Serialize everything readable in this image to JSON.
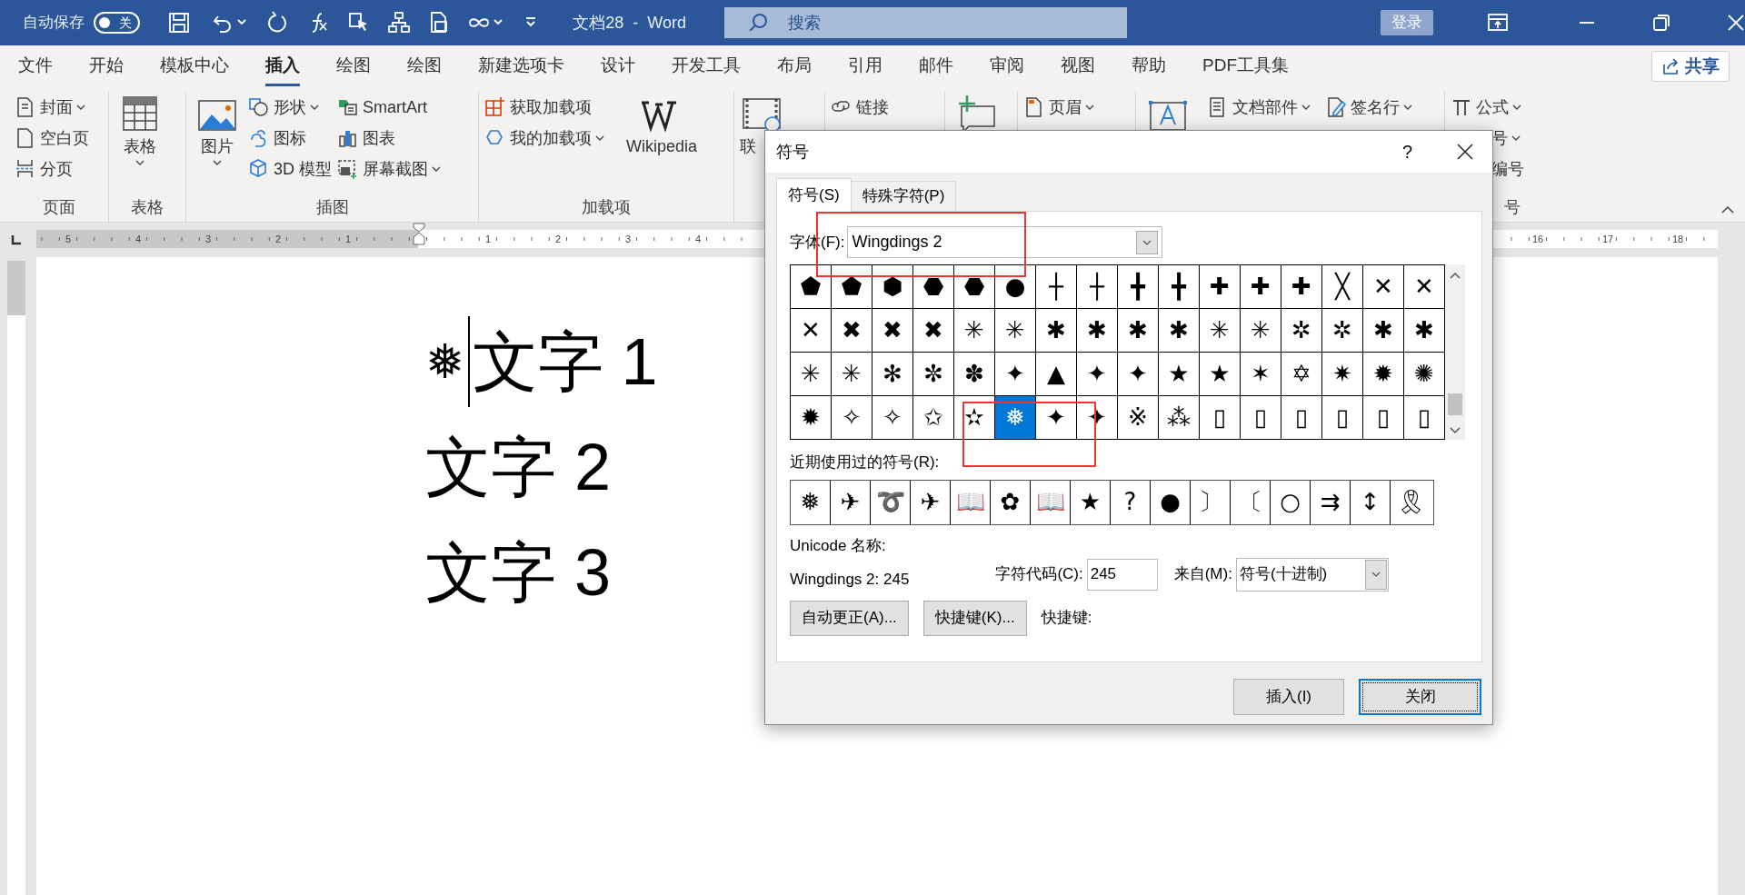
{
  "title_bar": {
    "autosave_label": "自动保存",
    "autosave": {
      "on": false,
      "label": "关"
    },
    "document_title": "文档28  -  Word",
    "search_placeholder": "搜索",
    "login": "登录"
  },
  "ribbon_tabs": [
    {
      "label": "文件",
      "selected": false
    },
    {
      "label": "开始",
      "selected": false
    },
    {
      "label": "模板中心",
      "selected": false
    },
    {
      "label": "插入",
      "selected": true
    },
    {
      "label": "绘图",
      "selected": false
    },
    {
      "label": "绘图",
      "selected": false
    },
    {
      "label": "新建选项卡",
      "selected": false
    },
    {
      "label": "设计",
      "selected": false
    },
    {
      "label": "开发工具",
      "selected": false
    },
    {
      "label": "布局",
      "selected": false
    },
    {
      "label": "引用",
      "selected": false
    },
    {
      "label": "邮件",
      "selected": false
    },
    {
      "label": "审阅",
      "selected": false
    },
    {
      "label": "视图",
      "selected": false
    },
    {
      "label": "帮助",
      "selected": false
    },
    {
      "label": "PDF工具集",
      "selected": false
    }
  ],
  "share": "共享",
  "ribbon_groups": [
    {
      "label": "页面",
      "columns": [
        [
          {
            "kind": "small",
            "label": "封面",
            "dropdown": true
          },
          {
            "kind": "small",
            "label": "空白页",
            "dropdown": false
          },
          {
            "kind": "small",
            "label": "分页",
            "dropdown": false
          }
        ]
      ]
    },
    {
      "label": "表格",
      "columns": [
        [
          {
            "kind": "large",
            "label": "表格",
            "dropdown": true
          }
        ]
      ]
    },
    {
      "label": "插图",
      "columns": [
        [
          {
            "kind": "large",
            "label": "图片",
            "dropdown": true
          }
        ],
        [
          {
            "kind": "small",
            "label": "形状",
            "dropdown": true
          },
          {
            "kind": "small",
            "label": "图标",
            "dropdown": false
          },
          {
            "kind": "small",
            "label": "3D 模型",
            "dropdown": false
          }
        ],
        [
          {
            "kind": "small",
            "label": "SmartArt",
            "dropdown": false
          },
          {
            "kind": "small",
            "label": "图表",
            "dropdown": false
          },
          {
            "kind": "small",
            "label": "屏幕截图",
            "dropdown": true
          }
        ]
      ]
    },
    {
      "label": "加载项",
      "columns": [
        [
          {
            "kind": "small",
            "label": "获取加载项",
            "dropdown": false
          },
          {
            "kind": "small",
            "label": "我的加载项",
            "dropdown": true
          }
        ],
        [
          {
            "kind": "large",
            "label": "Wikipedia",
            "dropdown": false
          }
        ]
      ]
    },
    {
      "columns": [
        [
          {
            "kind": "large",
            "label": "联",
            "dropdown": false
          }
        ]
      ]
    },
    {
      "columns": [
        [
          {
            "kind": "small",
            "label": "链接",
            "dropdown": false
          }
        ]
      ]
    },
    {
      "columns": [
        [
          {
            "kind": "large",
            "dropdown": false
          }
        ]
      ]
    },
    {
      "columns": [
        [
          {
            "kind": "small",
            "label": "页眉",
            "dropdown": true
          }
        ]
      ]
    },
    {
      "columns": [
        [
          {
            "kind": "large",
            "dropdown": false
          }
        ],
        [
          {
            "kind": "small",
            "label": "文档部件",
            "dropdown": true
          }
        ],
        [
          {
            "kind": "small",
            "label": "签名行",
            "dropdown": true
          }
        ]
      ]
    },
    {
      "label": "号",
      "columns": [
        [
          {
            "kind": "small",
            "label": "公式",
            "dropdown": true
          },
          {
            "kind": "small",
            "label": "号",
            "dropdown": true
          },
          {
            "kind": "small",
            "label": "编号",
            "dropdown": false
          }
        ]
      ]
    }
  ],
  "ruler": {
    "left_numbers": [
      "5",
      "4",
      "3",
      "2",
      "1"
    ],
    "right_numbers": [
      "1",
      "2",
      "3",
      "4"
    ],
    "far_numbers": [
      "16",
      "17",
      "18"
    ]
  },
  "document": {
    "lines": [
      {
        "symbol": "❅",
        "text": "文字 1",
        "cursor": true
      },
      {
        "text": "文字 2",
        "cursor": false
      },
      {
        "text": "文字 3",
        "cursor": false
      }
    ]
  },
  "dialog": {
    "title": "符号",
    "help": "?",
    "tabs": [
      {
        "label": "符号(S)",
        "selected": true
      },
      {
        "label": "特殊字符(P)",
        "selected": false
      }
    ],
    "font_label": "字体(F):",
    "font_value": "Wingdings 2",
    "symbols": [
      {
        "char": "⬟",
        "selected": false
      },
      {
        "char": "⬟",
        "selected": false
      },
      {
        "char": "⬢",
        "selected": false
      },
      {
        "char": "⬣",
        "selected": false
      },
      {
        "char": "⬣",
        "selected": false
      },
      {
        "char": "●",
        "selected": false
      },
      {
        "char": "┼",
        "selected": false
      },
      {
        "char": "┼",
        "selected": false
      },
      {
        "char": "╋",
        "selected": false
      },
      {
        "char": "╋",
        "selected": false
      },
      {
        "char": "✚",
        "selected": false
      },
      {
        "char": "✚",
        "selected": false
      },
      {
        "char": "✚",
        "selected": false
      },
      {
        "char": "╳",
        "selected": false
      },
      {
        "char": "✕",
        "selected": false
      },
      {
        "char": "✕",
        "selected": false
      },
      {
        "char": "✕",
        "selected": false
      },
      {
        "char": "✖",
        "selected": false
      },
      {
        "char": "✖",
        "selected": false
      },
      {
        "char": "✖",
        "selected": false
      },
      {
        "char": "✳",
        "selected": false
      },
      {
        "char": "✳",
        "selected": false
      },
      {
        "char": "✱",
        "selected": false
      },
      {
        "char": "✱",
        "selected": false
      },
      {
        "char": "✱",
        "selected": false
      },
      {
        "char": "✱",
        "selected": false
      },
      {
        "char": "✳",
        "selected": false
      },
      {
        "char": "✳",
        "selected": false
      },
      {
        "char": "✲",
        "selected": false
      },
      {
        "char": "✲",
        "selected": false
      },
      {
        "char": "✱",
        "selected": false
      },
      {
        "char": "✱",
        "selected": false
      },
      {
        "char": "✳",
        "selected": false
      },
      {
        "char": "✳",
        "selected": false
      },
      {
        "char": "✻",
        "selected": false
      },
      {
        "char": "✼",
        "selected": false
      },
      {
        "char": "✽",
        "selected": false
      },
      {
        "char": "✦",
        "selected": false
      },
      {
        "char": "▲",
        "selected": false
      },
      {
        "char": "✦",
        "selected": false
      },
      {
        "char": "✦",
        "selected": false
      },
      {
        "char": "★",
        "selected": false
      },
      {
        "char": "★",
        "selected": false
      },
      {
        "char": "✶",
        "selected": false
      },
      {
        "char": "✡",
        "selected": false
      },
      {
        "char": "✷",
        "selected": false
      },
      {
        "char": "✹",
        "selected": false
      },
      {
        "char": "✺",
        "selected": false
      },
      {
        "char": "✹",
        "selected": false
      },
      {
        "char": "✧",
        "selected": false
      },
      {
        "char": "✧",
        "selected": false
      },
      {
        "char": "✩",
        "selected": false
      },
      {
        "char": "✫",
        "selected": false
      },
      {
        "char": "❅",
        "selected": true
      },
      {
        "char": "✦",
        "selected": false
      },
      {
        "char": "✦",
        "selected": false
      },
      {
        "char": "※",
        "selected": false
      },
      {
        "char": "⁂",
        "selected": false
      },
      {
        "char": "▯",
        "selected": false
      },
      {
        "char": "▯",
        "selected": false
      },
      {
        "char": "▯",
        "selected": false
      },
      {
        "char": "▯",
        "selected": false
      },
      {
        "char": "▯",
        "selected": false
      },
      {
        "char": "▯",
        "selected": false
      }
    ],
    "recent_label": "近期使用过的符号(R):",
    "recent": [
      "❅",
      "✈",
      "➰",
      "✈",
      "📖",
      "✿",
      "📖",
      "★",
      "?",
      "●",
      "〕",
      "〔",
      "○",
      "⇉",
      "↕",
      "🎗"
    ],
    "unicode_name_label": "Unicode 名称:",
    "unicode_name_value": "Wingdings 2: 245",
    "code_label": "字符代码(C):",
    "code_value": "245",
    "from_label": "来自(M):",
    "from_value": "符号(十进制)",
    "autocorrect_button": "自动更正(A)...",
    "shortcut_button": "快捷键(K)...",
    "shortcut_label": "快捷键:",
    "insert_button": "插入(I)",
    "close_button": "关闭"
  }
}
